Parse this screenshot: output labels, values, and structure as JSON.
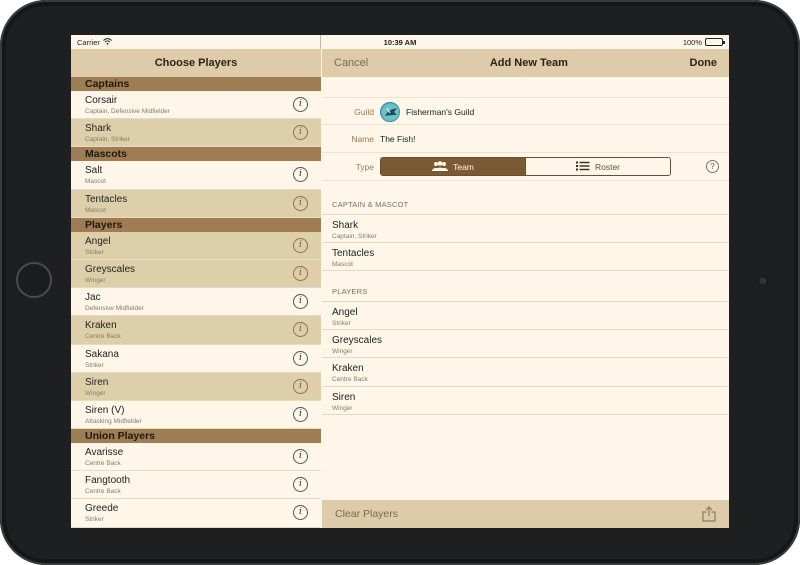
{
  "status_bar": {
    "carrier": "Carrier",
    "time": "10:39 AM",
    "battery": "100%"
  },
  "left_pane": {
    "title": "Choose Players",
    "sections": [
      {
        "title": "Captains",
        "players": [
          {
            "name": "Corsair",
            "role": "Captain, Defensive Midfielder",
            "selected": false
          },
          {
            "name": "Shark",
            "role": "Captain, Striker",
            "selected": true
          }
        ]
      },
      {
        "title": "Mascots",
        "players": [
          {
            "name": "Salt",
            "role": "Mascot",
            "selected": false
          },
          {
            "name": "Tentacles",
            "role": "Mascot",
            "selected": true
          }
        ]
      },
      {
        "title": "Players",
        "players": [
          {
            "name": "Angel",
            "role": "Striker",
            "selected": true
          },
          {
            "name": "Greyscales",
            "role": "Winger",
            "selected": true
          },
          {
            "name": "Jac",
            "role": "Defensive Midfielder",
            "selected": false
          },
          {
            "name": "Kraken",
            "role": "Centre Back",
            "selected": true
          },
          {
            "name": "Sakana",
            "role": "Striker",
            "selected": false
          },
          {
            "name": "Siren",
            "role": "Winger",
            "selected": true
          },
          {
            "name": "Siren (V)",
            "role": "Attacking Midfielder",
            "selected": false
          }
        ]
      },
      {
        "title": "Union Players",
        "players": [
          {
            "name": "Avarisse",
            "role": "Centre Back",
            "selected": false
          },
          {
            "name": "Fangtooth",
            "role": "Centre Back",
            "selected": false
          },
          {
            "name": "Greede",
            "role": "Striker",
            "selected": false
          }
        ]
      }
    ]
  },
  "right_pane": {
    "cancel_label": "Cancel",
    "title": "Add New Team",
    "done_label": "Done",
    "form": {
      "guild_label": "Guild",
      "guild_value": "Fisherman's Guild",
      "name_label": "Name",
      "name_value": "The Fish!",
      "type_label": "Type",
      "type_options": [
        "Team",
        "Roster"
      ],
      "type_selected": "Team",
      "help_label": "?"
    },
    "captain_mascot_title": "CAPTAIN & MASCOT",
    "captain_mascot": [
      {
        "name": "Shark",
        "role": "Captain, Striker"
      },
      {
        "name": "Tentacles",
        "role": "Mascot"
      }
    ],
    "players_title": "PLAYERS",
    "players": [
      {
        "name": "Angel",
        "role": "Striker"
      },
      {
        "name": "Greyscales",
        "role": "Winger"
      },
      {
        "name": "Kraken",
        "role": "Centre Back"
      },
      {
        "name": "Siren",
        "role": "Winger"
      }
    ],
    "clear_label": "Clear Players"
  },
  "colors": {
    "header_bg": "#ddcbaa",
    "section_bg": "#a07c52",
    "selected_row": "#ddcfa9",
    "background": "#fdf6e9",
    "segment_active": "#7a5a33"
  },
  "icons": {
    "info": "info-icon",
    "help": "help-icon",
    "team": "team-icon",
    "roster": "list-icon",
    "share": "share-icon",
    "guild_logo": "fisherman-guild-logo"
  }
}
